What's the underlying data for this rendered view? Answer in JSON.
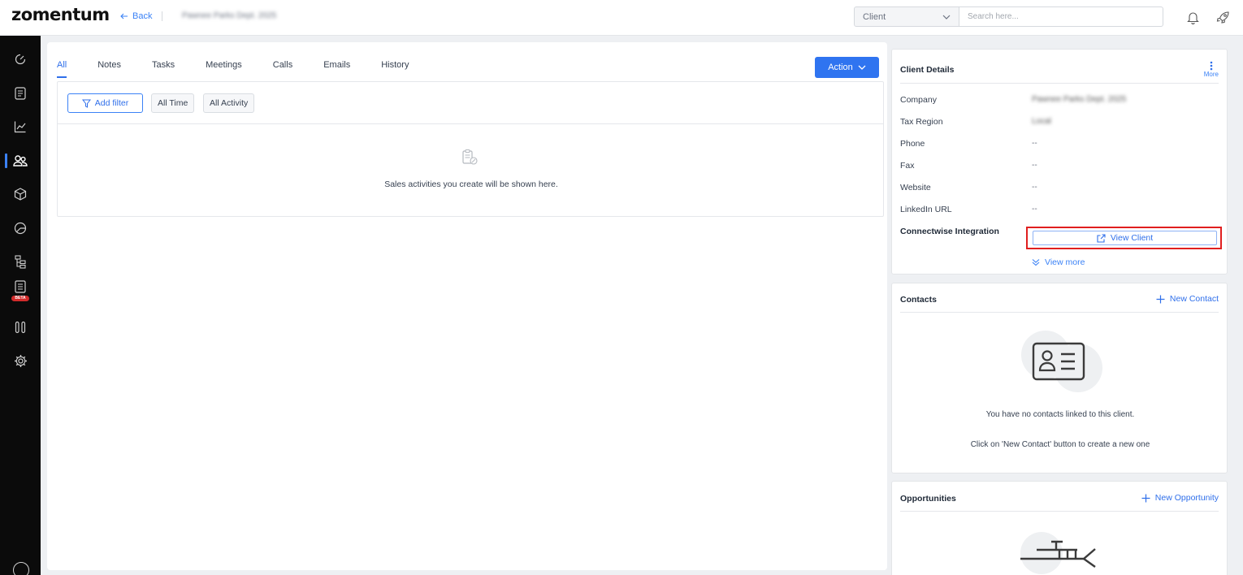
{
  "header": {
    "logo": "zomentum",
    "back_label": "Back",
    "breadcrumb": "Pawnee Parks Dept. 2025",
    "search_scope": "Client",
    "search_placeholder": "Search here..."
  },
  "sidebar": {
    "items": [
      {
        "icon": "dashboard-icon"
      },
      {
        "icon": "document-icon"
      },
      {
        "icon": "analytics-icon"
      },
      {
        "icon": "clients-icon",
        "active": true
      },
      {
        "icon": "products-icon"
      },
      {
        "icon": "reports-icon"
      },
      {
        "icon": "hierarchy-icon"
      },
      {
        "icon": "quotes-icon",
        "badge": "BETA"
      },
      {
        "icon": "pipeline-icon"
      },
      {
        "icon": "settings-icon"
      }
    ]
  },
  "main": {
    "tabs": [
      {
        "label": "All",
        "active": true
      },
      {
        "label": "Notes"
      },
      {
        "label": "Tasks"
      },
      {
        "label": "Meetings"
      },
      {
        "label": "Calls"
      },
      {
        "label": "Emails"
      },
      {
        "label": "History"
      }
    ],
    "action_label": "Action",
    "filters": {
      "add_filter": "Add filter",
      "time": "All Time",
      "activity": "All Activity"
    },
    "empty_message": "Sales activities you create will be shown here."
  },
  "client_details": {
    "title": "Client Details",
    "more_label": "More",
    "rows": [
      {
        "label": "Company",
        "value": "Pawnee Parks Dept. 2025"
      },
      {
        "label": "Tax Region",
        "value": "Local"
      },
      {
        "label": "Phone",
        "value": "--"
      },
      {
        "label": "Fax",
        "value": "--"
      },
      {
        "label": "Website",
        "value": "--"
      },
      {
        "label": "LinkedIn URL",
        "value": "--"
      }
    ],
    "integration_label": "Connectwise Integration",
    "view_client_label": "View Client",
    "view_more_label": "View more"
  },
  "contacts": {
    "title": "Contacts",
    "new_label": "New Contact",
    "empty_line1": "You have no contacts linked to this client.",
    "empty_line2": "Click on 'New Contact' button to create a new one"
  },
  "opportunities": {
    "title": "Opportunities",
    "new_label": "New Opportunity"
  },
  "colors": {
    "accent": "#2f6fea",
    "highlight": "#e01f1f",
    "sidebar_bg": "#0b0b0b",
    "beta_badge": "#d22b2b"
  }
}
